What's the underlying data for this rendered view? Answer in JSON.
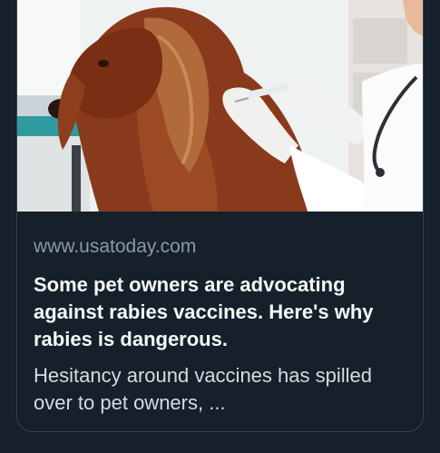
{
  "card": {
    "domain": "www.usatoday.com",
    "headline": "Some pet owners are advocating against rabies vaccines. Here's why rabies is dangerous.",
    "description": "Hesitancy around vaccines has spilled over to pet owners, ...",
    "image_subject": "dog-receiving-vaccine-photo"
  },
  "colors": {
    "background": "#15202b",
    "border": "#38444d",
    "domain_text": "#8b98a5",
    "headline_text": "#f7f9f9",
    "description_text": "#d5dbe0"
  }
}
